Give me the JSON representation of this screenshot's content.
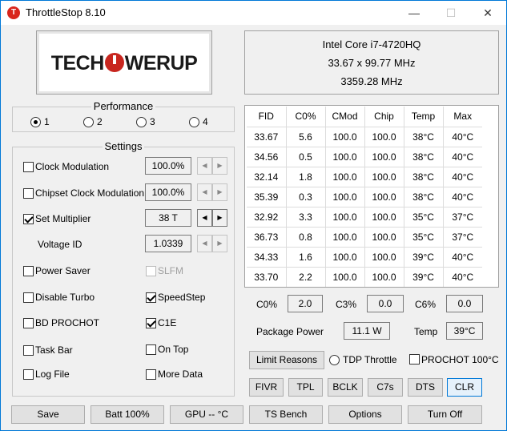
{
  "window": {
    "title": "ThrottleStop 8.10",
    "app_icon": "T",
    "minimize": "—",
    "maximize": "☐",
    "close": "✕"
  },
  "logo": {
    "left": "TECH",
    "right": "WERUP",
    "accent": "#c8261f"
  },
  "cpu": {
    "name": "Intel Core i7-4720HQ",
    "multiplier": "33.67 x 99.77 MHz",
    "freq": "3359.28 MHz"
  },
  "performance": {
    "title": "Performance",
    "options": [
      "1",
      "2",
      "3",
      "4"
    ],
    "selected": "1"
  },
  "settings": {
    "title": "Settings",
    "clock_mod": {
      "label": "Clock Modulation",
      "checked": false,
      "value": "100.0%"
    },
    "chipset_mod": {
      "label": "Chipset Clock Modulation",
      "checked": false,
      "value": "100.0%"
    },
    "set_mult": {
      "label": "Set Multiplier",
      "checked": true,
      "value": "38 T"
    },
    "voltage": {
      "label": "Voltage ID",
      "value": "1.0339"
    },
    "power_saver": {
      "label": "Power Saver",
      "checked": false
    },
    "slfm": {
      "label": "SLFM",
      "checked": false
    },
    "disable_turbo": {
      "label": "Disable Turbo",
      "checked": false
    },
    "speedstep": {
      "label": "SpeedStep",
      "checked": true
    },
    "bd_prochot": {
      "label": "BD PROCHOT",
      "checked": false
    },
    "c1e": {
      "label": "C1E",
      "checked": true
    },
    "task_bar": {
      "label": "Task Bar",
      "checked": false
    },
    "on_top": {
      "label": "On Top",
      "checked": false
    },
    "log_file": {
      "label": "Log File",
      "checked": false
    },
    "more_data": {
      "label": "More Data",
      "checked": false
    },
    "spin_left": "◀",
    "spin_right": "▶"
  },
  "table": {
    "headers": [
      "FID",
      "C0%",
      "CMod",
      "Chip",
      "Temp",
      "Max"
    ],
    "rows": [
      [
        "33.67",
        "5.6",
        "100.0",
        "100.0",
        "38°C",
        "40°C"
      ],
      [
        "34.56",
        "0.5",
        "100.0",
        "100.0",
        "38°C",
        "40°C"
      ],
      [
        "32.14",
        "1.8",
        "100.0",
        "100.0",
        "38°C",
        "40°C"
      ],
      [
        "35.39",
        "0.3",
        "100.0",
        "100.0",
        "38°C",
        "40°C"
      ],
      [
        "32.92",
        "3.3",
        "100.0",
        "100.0",
        "35°C",
        "37°C"
      ],
      [
        "36.73",
        "0.8",
        "100.0",
        "100.0",
        "35°C",
        "37°C"
      ],
      [
        "34.33",
        "1.6",
        "100.0",
        "100.0",
        "39°C",
        "40°C"
      ],
      [
        "33.70",
        "2.2",
        "100.0",
        "100.0",
        "39°C",
        "40°C"
      ]
    ]
  },
  "cstates": {
    "c0_label": "C0%",
    "c0": "2.0",
    "c3_label": "C3%",
    "c3": "0.0",
    "c6_label": "C6%",
    "c6": "0.0"
  },
  "power": {
    "label": "Package Power",
    "value": "11.1 W",
    "temp_label": "Temp",
    "temp": "39°C"
  },
  "limits": {
    "button": "Limit Reasons",
    "tdp_label": "TDP Throttle",
    "prochot_label": "PROCHOT 100°C"
  },
  "tool_buttons": [
    "FIVR",
    "TPL",
    "BCLK",
    "C7s",
    "DTS",
    "CLR"
  ],
  "bottom_buttons": [
    "Save",
    "Batt 100%",
    "GPU -- °C",
    "TS Bench",
    "Options",
    "Turn Off"
  ]
}
